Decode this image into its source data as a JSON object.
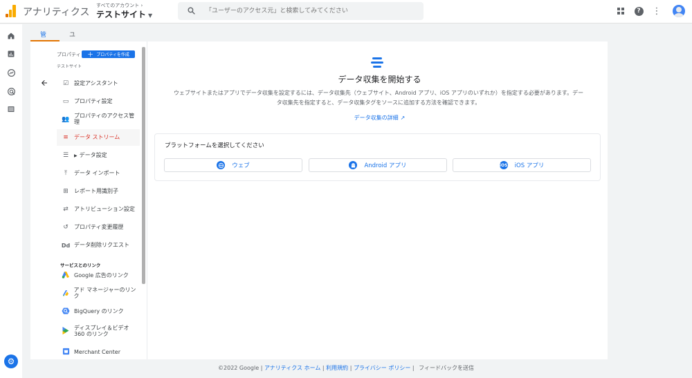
{
  "header": {
    "app_title": "アナリティクス",
    "account_crumb": "すべてのアカウント",
    "property_name": "テストサイト",
    "search_placeholder": "「ユーザーのアクセス元」と検索してみてください"
  },
  "tabs": [
    {
      "label": "管理",
      "active": true
    },
    {
      "label": "ユーザー",
      "active": false
    }
  ],
  "sidebar": {
    "heading": "プロパティ",
    "create_button": "プロパティを作成",
    "property_name": "テストサイト",
    "items": [
      {
        "label": "設定アシスタント",
        "icon": "checklist-icon"
      },
      {
        "label": "プロパティ設定",
        "icon": "settings-page-icon"
      },
      {
        "label": "プロパティのアクセス管理",
        "icon": "people-icon"
      },
      {
        "label": "データ ストリーム",
        "icon": "streams-icon",
        "active": true
      },
      {
        "label": "データ設定",
        "icon": "database-icon"
      },
      {
        "label": "データ インポート",
        "icon": "upload-icon"
      },
      {
        "label": "レポート用識別子",
        "icon": "identity-icon"
      },
      {
        "label": "アトリビューション設定",
        "icon": "attribution-icon"
      },
      {
        "label": "プロパティ変更履歴",
        "icon": "history-icon"
      },
      {
        "label": "データ削除リクエスト",
        "icon": "delete-data-icon"
      }
    ],
    "links_section": "サービスとのリンク",
    "links": [
      {
        "label": "Google 広告のリンク",
        "icon": "google-ads-icon"
      },
      {
        "label": "アド マネージャーのリンク",
        "icon": "ad-manager-icon"
      },
      {
        "label": "BigQuery のリンク",
        "icon": "bigquery-icon"
      },
      {
        "label": "ディスプレイ＆ビデオ 360 のリンク",
        "icon": "display-video-icon"
      },
      {
        "label": "Merchant Center",
        "icon": "merchant-center-icon"
      }
    ]
  },
  "main": {
    "title": "データ収集を開始する",
    "description": "ウェブサイトまたはアプリでデータ収集を設定するには、データ収集先（ウェブサイト、Android アプリ、iOS アプリのいずれか）を指定する必要があります。データ収集先を指定すると、データ収集タグをソースに追加する方法を確認できます。",
    "learn_more": "データ収集の詳細",
    "platform_heading": "プラットフォームを選択してください",
    "platforms": [
      {
        "label": "ウェブ",
        "icon": "globe-icon"
      },
      {
        "label": "Android アプリ",
        "icon": "android-icon"
      },
      {
        "label": "iOS アプリ",
        "icon": "ios-icon"
      }
    ]
  },
  "footer": {
    "copyright": "©2022 Google",
    "links": [
      "アナリティクス ホーム",
      "利用規約",
      "プライバシー ポリシー"
    ],
    "feedback": "フィードバックを送信"
  },
  "colors": {
    "accent_blue": "#1a73e8",
    "active_red": "#d93025",
    "tab_underline": "#e37400"
  }
}
